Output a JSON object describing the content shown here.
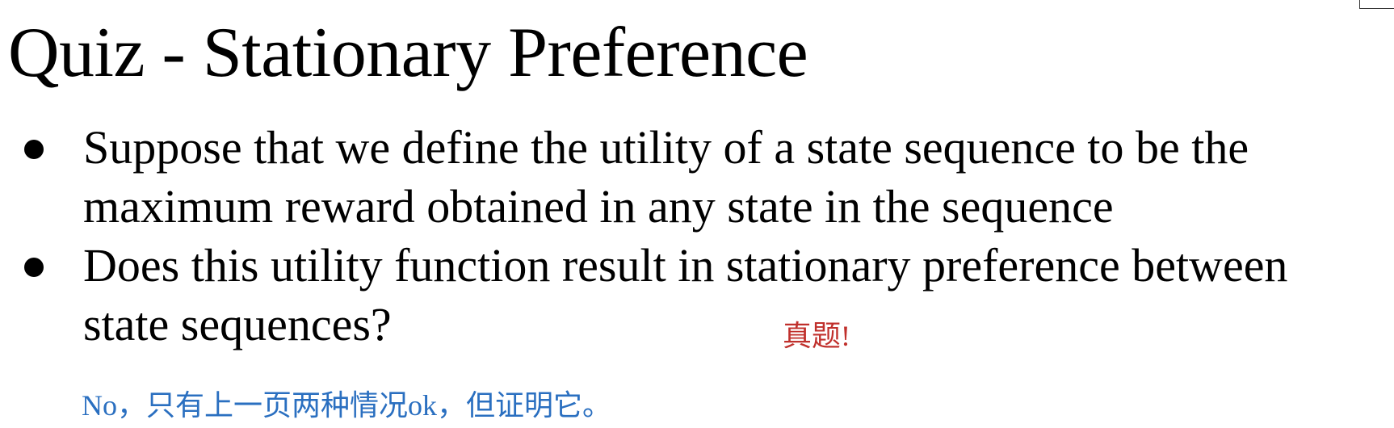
{
  "slide": {
    "title": "Quiz - Stationary Preference",
    "bullets": [
      {
        "lines": [
          "Suppose that we define the utility of a state sequence to be the",
          "maximum reward obtained in any state in the sequence"
        ]
      },
      {
        "lines": [
          "Does this utility function result in stationary preference between",
          "state sequences?"
        ]
      }
    ],
    "annotations": {
      "red_note": "真题!",
      "blue_note": "No，只有上一页两种情况ok，但证明它。"
    }
  },
  "colors": {
    "text": "#000000",
    "red_note": "#c0302c",
    "blue_note": "#2a6fc0",
    "background": "#ffffff"
  }
}
